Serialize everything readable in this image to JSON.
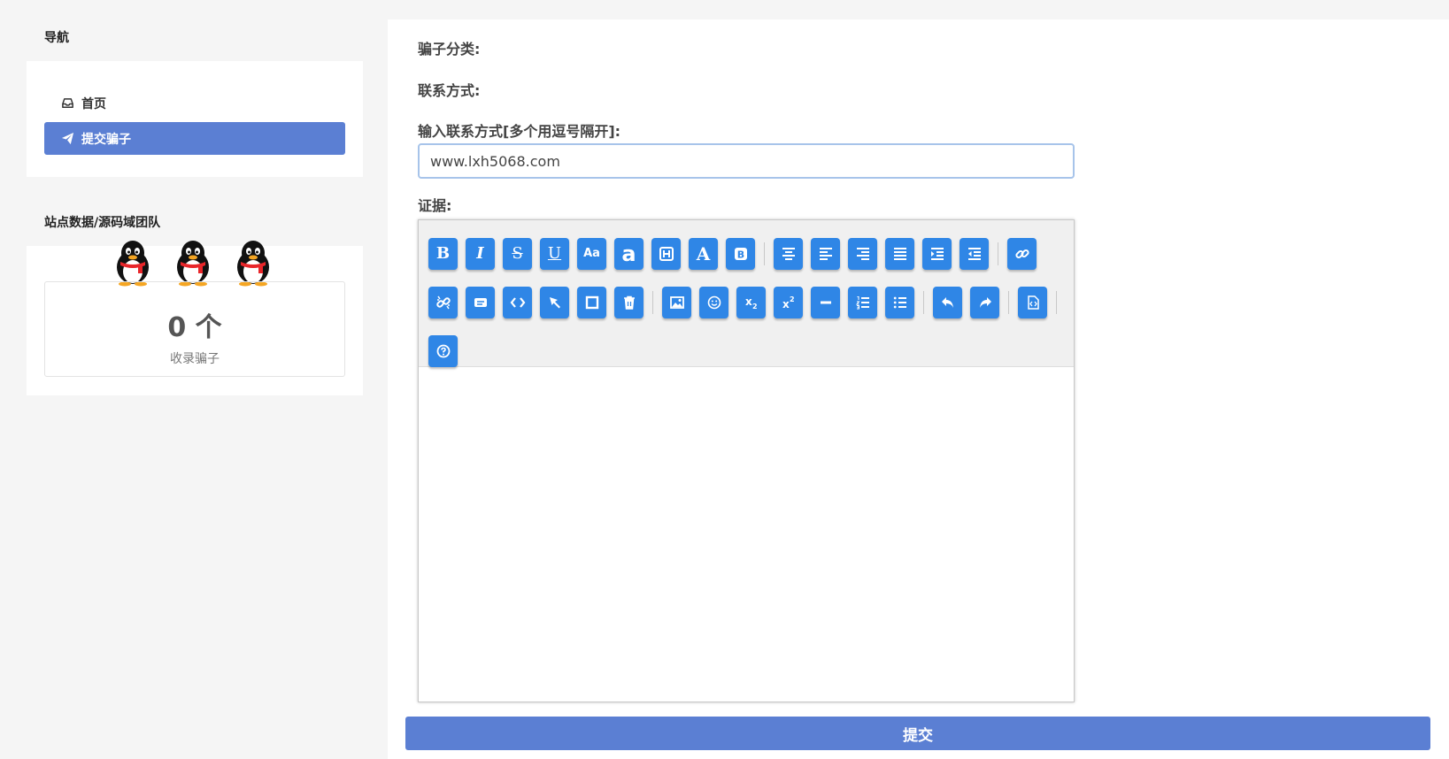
{
  "nav": {
    "title": "导航",
    "items": [
      {
        "label": "首页",
        "icon": "inbox-icon",
        "active": false
      },
      {
        "label": "提交骗子",
        "icon": "paper-plane-icon",
        "active": true
      }
    ]
  },
  "stats": {
    "title": "站点数据/源码域团队",
    "count": "0 个",
    "count_label": "收录骗子",
    "penguin_icons": [
      "qq-penguin-icon",
      "qq-penguin-icon",
      "qq-penguin-icon"
    ]
  },
  "form": {
    "category_label": "骗子分类:",
    "contact_label": "联系方式:",
    "contact_input_label": "输入联系方式[多个用逗号隔开]:",
    "contact_input_value": "www.lxh5068.com",
    "evidence_label": "证据:",
    "submit_label": "提交"
  },
  "editor": {
    "toolbar_rows": [
      [
        "bold-icon",
        "italic-icon",
        "strikethrough-icon",
        "underline-icon",
        "font-size-icon",
        "font-face-icon",
        "heading-icon",
        "font-color-icon",
        "background-color-icon",
        "|",
        "align-center-icon",
        "align-left-icon",
        "align-right-icon",
        "align-justify-icon",
        "indent-icon",
        "outdent-icon",
        "|",
        "link-icon"
      ],
      [
        "unlink-icon",
        "quote-icon",
        "code-icon",
        "pointer-icon",
        "table-icon",
        "clear-icon",
        "|",
        "image-icon",
        "emoji-icon",
        "subscript-icon",
        "superscript-icon",
        "horizontal-rule-icon",
        "ordered-list-icon",
        "unordered-list-icon",
        "|",
        "undo-icon",
        "redo-icon",
        "|",
        "source-icon",
        "|"
      ],
      [
        "help-icon"
      ]
    ]
  },
  "colors": {
    "accent": "#5b7fd3",
    "toolbar_button": "#2f86e6",
    "background": "#f5f5f5"
  }
}
